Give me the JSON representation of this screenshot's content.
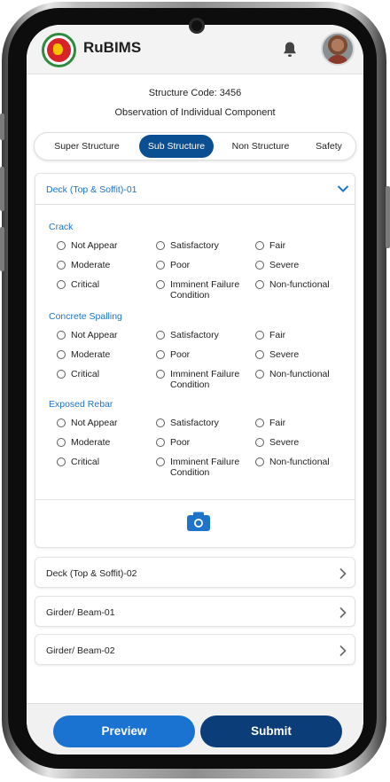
{
  "app": {
    "title": "RuBIMS"
  },
  "info": {
    "structure_code": "Structure Code: 3456",
    "subtitle": "Observation of Individual Component"
  },
  "tabs": [
    {
      "label": "Super Structure",
      "active": false
    },
    {
      "label": "Sub Structure",
      "active": true
    },
    {
      "label": "Non Structure",
      "active": false
    },
    {
      "label": "Safety",
      "active": false
    }
  ],
  "expanded_component": {
    "title": "Deck (Top & Soffit)-01",
    "sections": [
      {
        "title": "Crack",
        "options": [
          "Not Appear",
          "Satisfactory",
          "Fair",
          "Moderate",
          "Poor",
          "Severe",
          "Critical",
          "Imminent Failure\nCondition",
          "Non-functional"
        ]
      },
      {
        "title": "Concrete Spalling",
        "options": [
          "Not Appear",
          "Satisfactory",
          "Fair",
          "Moderate",
          "Poor",
          "Severe",
          "Critical",
          "Imminent Failure\nCondition",
          "Non-functional"
        ]
      },
      {
        "title": "Exposed Rebar",
        "options": [
          "Not Appear",
          "Satisfactory",
          "Fair",
          "Moderate",
          "Poor",
          "Severe",
          "Critical",
          "Imminent Failure\nCondition",
          "Non-functional"
        ]
      }
    ]
  },
  "collapsed_components": [
    {
      "label": "Deck (Top & Soffit)-02"
    },
    {
      "label": "Girder/ Beam-01"
    },
    {
      "label": "Girder/ Beam-02"
    }
  ],
  "footer": {
    "preview_label": "Preview",
    "submit_label": "Submit"
  },
  "colors": {
    "accent": "#1f73c8",
    "tab_active": "#0b4f93",
    "preview": "#1a73d1",
    "submit": "#0b3d78"
  },
  "icons": {
    "bell": "bell-icon",
    "camera": "camera-icon",
    "expand": "chevron-down-icon",
    "row": "chevron-right-icon"
  }
}
